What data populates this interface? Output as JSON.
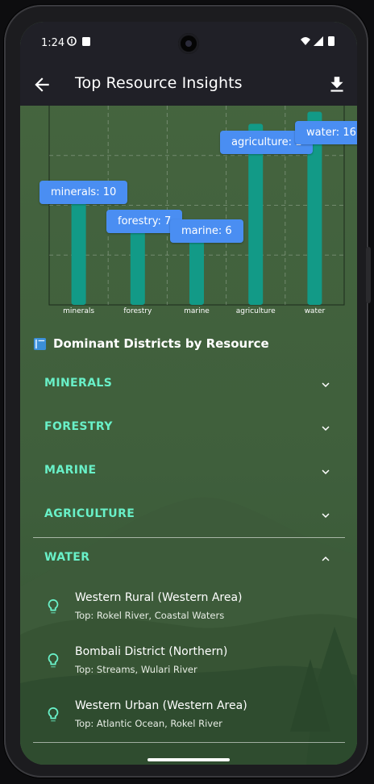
{
  "status_bar": {
    "time": "1:24"
  },
  "app_bar": {
    "title": "Top Resource Insights"
  },
  "chart_data": {
    "type": "bar",
    "categories": [
      "minerals",
      "forestry",
      "marine",
      "agriculture",
      "water"
    ],
    "values": [
      10,
      7,
      6,
      15,
      16
    ],
    "ylim": [
      0,
      16.5
    ],
    "grid": true,
    "bar_color": "#129a87",
    "tooltips": [
      "minerals: 10",
      "forestry: 7",
      "marine: 6",
      "agriculture: 1",
      "water: 16"
    ]
  },
  "section": {
    "title": "Dominant Districts by Resource"
  },
  "resources": [
    {
      "label": "MINERALS",
      "expanded": false
    },
    {
      "label": "FORESTRY",
      "expanded": false
    },
    {
      "label": "MARINE",
      "expanded": false
    },
    {
      "label": "AGRICULTURE",
      "expanded": false
    },
    {
      "label": "WATER",
      "expanded": true
    }
  ],
  "water_districts": [
    {
      "name": "Western Rural (Western Area)",
      "top": "Top: Rokel River, Coastal Waters"
    },
    {
      "name": "Bombali District (Northern)",
      "top": "Top: Streams, Wulari River"
    },
    {
      "name": "Western Urban (Western Area)",
      "top": "Top: Atlantic Ocean, Rokel River"
    }
  ],
  "colors": {
    "accent": "#69f0c8",
    "tooltip": "#4a8ef2",
    "bar": "#129a87",
    "appbar": "#202027"
  }
}
